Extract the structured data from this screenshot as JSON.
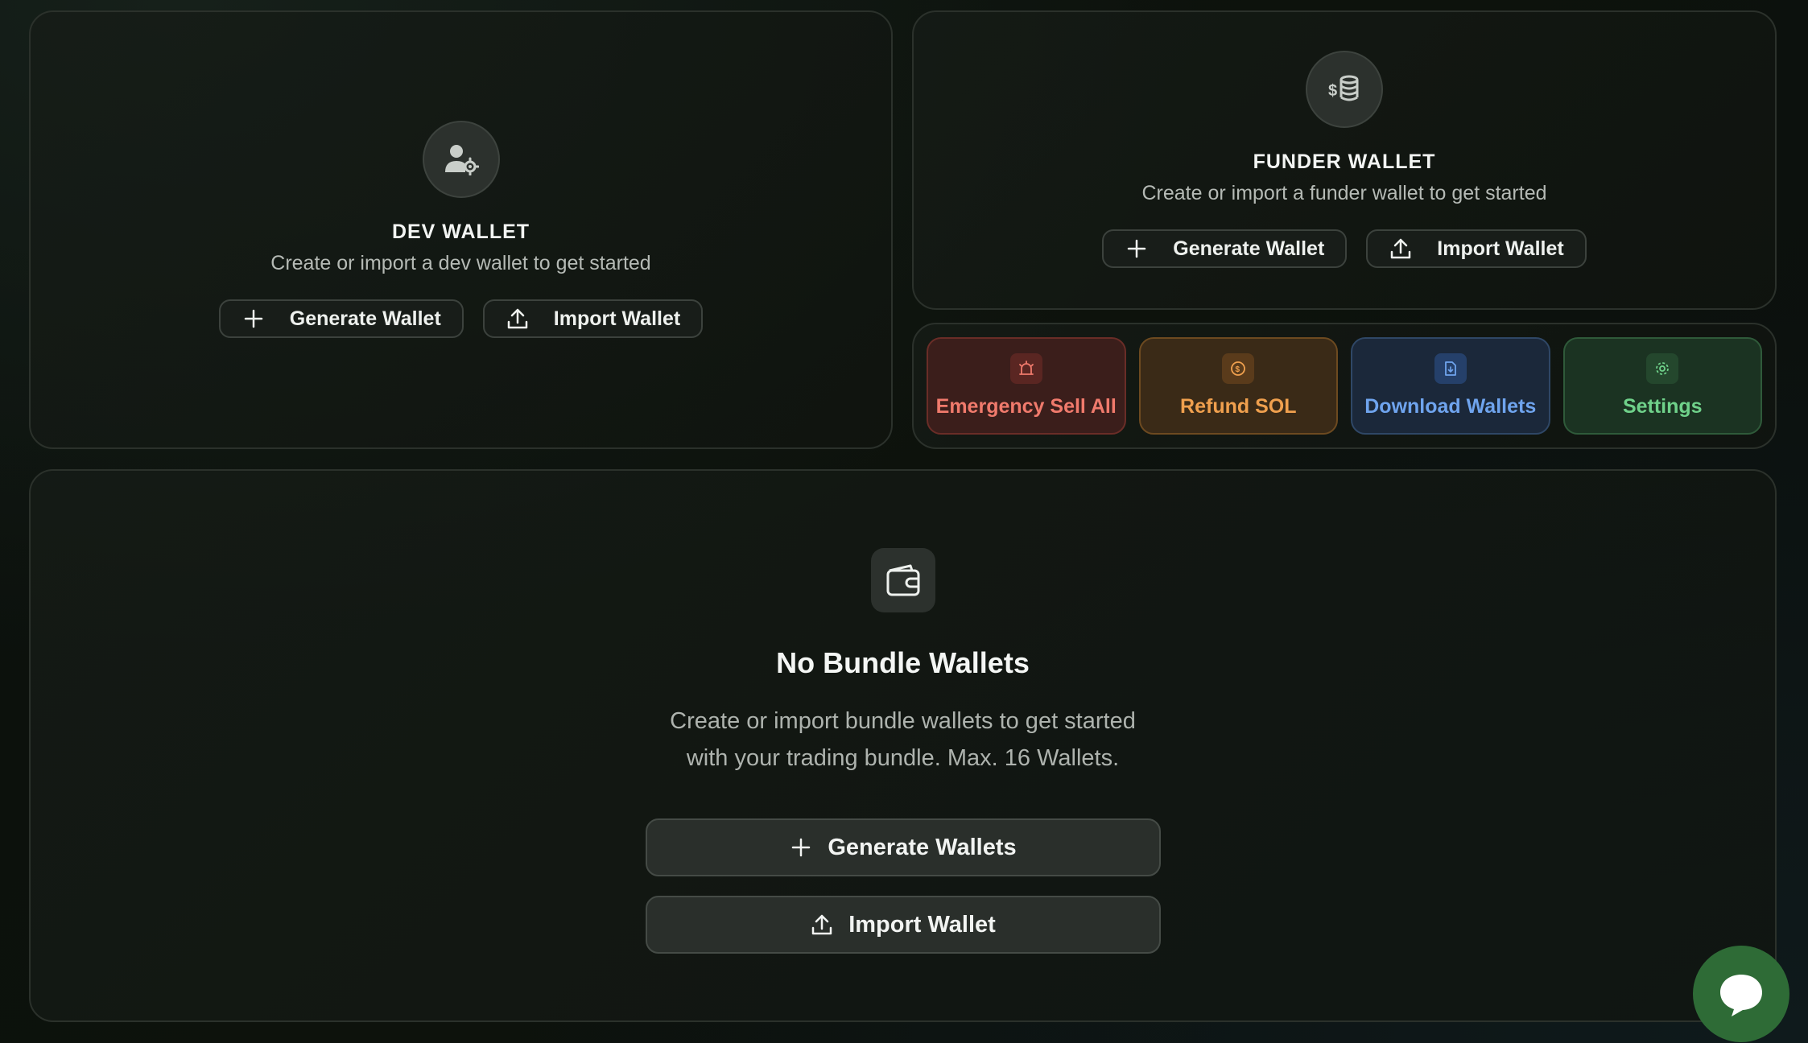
{
  "dev_wallet": {
    "icon": "user-gear-icon",
    "title": "DEV WALLET",
    "subtitle": "Create or import a dev wallet to get started",
    "generate_label": "Generate Wallet",
    "import_label": "Import Wallet"
  },
  "funder_wallet": {
    "icon": "dollar-coins-icon",
    "title": "FUNDER WALLET",
    "subtitle": "Create or import a funder wallet to get started",
    "generate_label": "Generate Wallet",
    "import_label": "Import Wallet"
  },
  "actions": [
    {
      "label": "Emergency Sell All",
      "icon": "alarm-icon",
      "color": "#f07a6c"
    },
    {
      "label": "Refund SOL",
      "icon": "coin-icon",
      "color": "#f0a04e"
    },
    {
      "label": "Download Wallets",
      "icon": "file-download-icon",
      "color": "#6fa4ee"
    },
    {
      "label": "Settings",
      "icon": "gear-icon",
      "color": "#6fd18a"
    }
  ],
  "bundle": {
    "icon": "wallet-icon",
    "title": "No Bundle Wallets",
    "subtitle_line1": "Create or import bundle wallets to get started",
    "subtitle_line2": "with your trading bundle. Max. 16 Wallets.",
    "generate_label": "Generate Wallets",
    "import_label": "Import Wallet"
  },
  "chat": {
    "icon": "chat-bubble-icon",
    "color": "#2e6b36"
  }
}
